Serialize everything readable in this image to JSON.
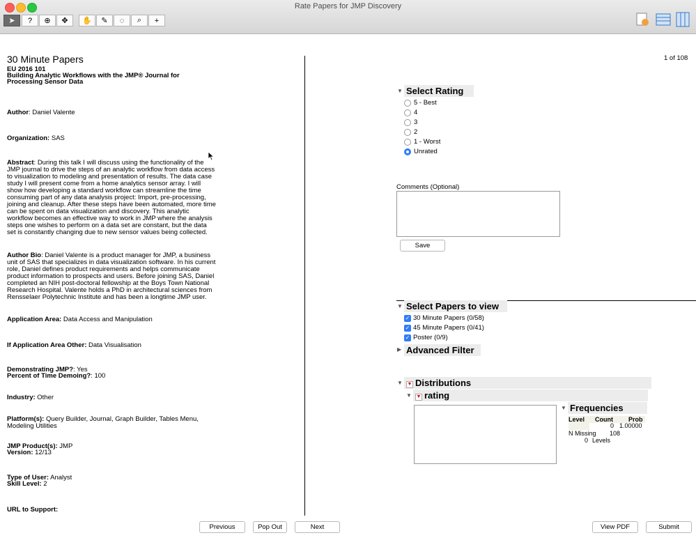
{
  "window": {
    "title": "Rate Papers for JMP Discovery"
  },
  "colors": {
    "accent": "#2f7cf6",
    "traffic_close": "#fc5f57",
    "traffic_min": "#fdbc2e",
    "traffic_max": "#28c840"
  },
  "toolbar": {
    "tools": [
      {
        "name": "arrow-tool-icon",
        "glyph": "➤"
      },
      {
        "name": "help-tool-icon",
        "glyph": "?"
      },
      {
        "name": "selection-tool-icon",
        "glyph": "⊕"
      },
      {
        "name": "scroller-tool-icon",
        "glyph": "✥"
      },
      {
        "name": "grabber-tool-icon",
        "glyph": "✋"
      },
      {
        "name": "brush-tool-icon",
        "glyph": "✎"
      },
      {
        "name": "lasso-tool-icon",
        "glyph": "◌"
      },
      {
        "name": "magnifier-tool-icon",
        "glyph": "⌕"
      },
      {
        "name": "crosshair-tool-icon",
        "glyph": "+"
      }
    ]
  },
  "paper": {
    "section": "30 Minute Papers",
    "id": "EU 2016 101",
    "title_line1": "Building Analytic Workflows with the JMP® Journal for",
    "title_line2": "Processing Sensor Data",
    "author_label": "Author",
    "author": ": Daniel Valente",
    "org_label": "Organization:",
    "org": " SAS",
    "abstract_label": "Abstract",
    "abstract": ": During this talk I will discuss using the functionality of the JMP journal to drive the steps of an analytic workflow from data access to visualization to modeling and presentation of results. The data case study I will present come from a home analytics sensor array. I will show how developing a standard workflow can streamline the time consuming part of any data analysis project: Import, pre-processing, joining and cleanup. After these steps have been automated, more time can be spent on data visualization and discovery. This analytic workflow becomes an effective way to work in JMP where the analysis steps one wishes to perform on a data set are constant, but the data set is constantly changing due to new sensor values being collected.",
    "bio_label": "Author Bio",
    "bio": ": Daniel Valente is a product manager for JMP, a business unit of SAS that specializes in data visualization software. In his current role, Daniel defines product requirements and helps communicate product information to prospects and users.  Before joining SAS, Daniel completed an NIH post-doctoral fellowship at the Boys Town National Research Hospital. Valente holds a PhD in architectural sciences from Rensselaer Polytechnic Institute and has been a longtime JMP user.",
    "app_area_label": "Application Area:",
    "app_area": " Data Access and Manipulation",
    "app_other_label": "If Application Area Other:",
    "app_other": " Data Visualisation",
    "demo_label": "Demonstrating JMP?",
    "demo": ": Yes",
    "percent_label": "Percent of Time Demoing?",
    "percent": ": 100",
    "industry_label": "Industry:",
    "industry": " Other",
    "platform_label": "Platform(s):",
    "platform": " Query Builder, Journal, Graph Builder, Tables Menu, Modeling Utilities",
    "product_label": "JMP Product(s):",
    "product": " JMP",
    "version_label": "Version:",
    "version": " 12/13",
    "usertype_label": "Type of User:",
    "usertype": " Analyst",
    "skill_label": "Skill Level:",
    "skill": " 2",
    "url_label": "URL to Support:"
  },
  "pager": {
    "position": "1 of 108"
  },
  "rating": {
    "heading": "Select Rating",
    "options": [
      "5 - Best",
      "4",
      "3",
      "2",
      "1 - Worst",
      "Unrated"
    ],
    "selected": "Unrated"
  },
  "comments": {
    "label": "Comments (Optional)",
    "value": "",
    "save": "Save"
  },
  "papers_view": {
    "heading": "Select Papers to view",
    "items": [
      "30 Minute Papers (0/58)",
      "45 Minute Papers (0/41)",
      "Poster (0/9)"
    ],
    "advanced": "Advanced Filter"
  },
  "distributions": {
    "heading": "Distributions",
    "variable": "rating",
    "freq_heading": "Frequencies",
    "headers": [
      "Level",
      "Count",
      "Prob"
    ],
    "row": {
      "count": "0",
      "prob": "1.00000"
    },
    "n_missing_label": "N Missing",
    "n_missing": "108",
    "levels_count": "0",
    "levels_label": "Levels"
  },
  "footer": {
    "previous": "Previous",
    "popout": "Pop Out",
    "next": "Next",
    "view_pdf": "View PDF",
    "submit": "Submit"
  }
}
